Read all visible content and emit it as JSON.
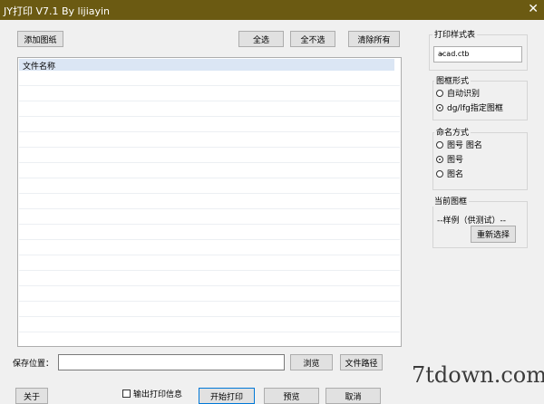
{
  "window": {
    "title": "JY打印 V7.1 By lijiayin",
    "close_glyph": "✕"
  },
  "toolbar": {
    "add_drawing": "添加图纸",
    "select_all": "全选",
    "select_none": "全不选",
    "clear_all": "清除所有"
  },
  "file_list": {
    "header": "文件名称"
  },
  "print_style": {
    "label": "打印样式表",
    "value": "acad.ctb"
  },
  "frame_type": {
    "label": "图框形式",
    "options": [
      {
        "label": "自动识别",
        "checked": false
      },
      {
        "label": "dg/lfg指定图框",
        "checked": true
      }
    ]
  },
  "naming": {
    "label": "命名方式",
    "options": [
      {
        "label": "图号 图名",
        "checked": false
      },
      {
        "label": "图号",
        "checked": true
      },
      {
        "label": "图名",
        "checked": false
      }
    ]
  },
  "current_frame": {
    "label": "当前图框",
    "value": "--样例（供测试）--",
    "reselect": "重新选择"
  },
  "save": {
    "label": "保存位置：",
    "path": "",
    "browse": "浏览",
    "file_path": "文件路径"
  },
  "bottom": {
    "about": "关于",
    "output_info": "输出打印信息",
    "start": "开始打印",
    "prev": "预览",
    "cancel": "取消"
  },
  "watermark": "7tdown.com"
}
